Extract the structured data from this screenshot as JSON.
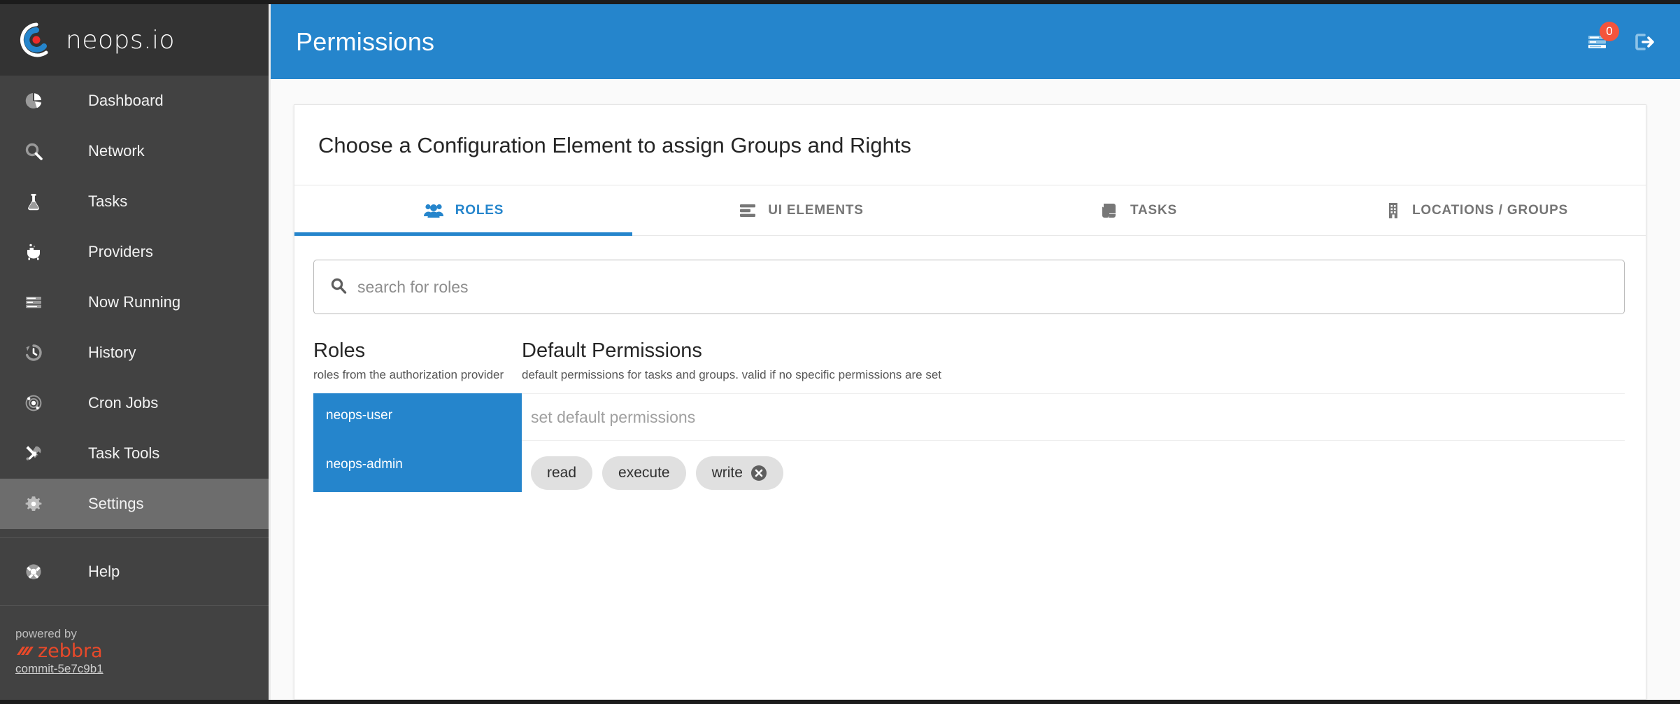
{
  "brand": {
    "name": "neops.io",
    "logo_icon": "neops-target-logo"
  },
  "sidebar": {
    "items": [
      {
        "label": "Dashboard",
        "icon": "pie-chart-icon",
        "active": false
      },
      {
        "label": "Network",
        "icon": "magnifier-icon",
        "active": false
      },
      {
        "label": "Tasks",
        "icon": "flask-icon",
        "active": false
      },
      {
        "label": "Providers",
        "icon": "cauldron-icon",
        "active": false
      },
      {
        "label": "Now Running",
        "icon": "list-lines-icon",
        "active": false
      },
      {
        "label": "History",
        "icon": "history-clock-icon",
        "active": false
      },
      {
        "label": "Cron Jobs",
        "icon": "orbit-icon",
        "active": false
      },
      {
        "label": "Task Tools",
        "icon": "wrench-screwdriver-icon",
        "active": false
      },
      {
        "label": "Settings",
        "icon": "gear-icon",
        "active": true
      }
    ],
    "help": {
      "label": "Help",
      "icon": "lifebuoy-icon"
    },
    "footer": {
      "powered_by": "powered by",
      "vendor": "zebbra",
      "commit": "commit-5e7c9b1"
    }
  },
  "topbar": {
    "title": "Permissions",
    "running_badge": "0",
    "running_icon": "running-tasks-icon",
    "logout_icon": "logout-icon"
  },
  "card": {
    "title": "Choose a Configuration Element to assign Groups and Rights",
    "tabs": [
      {
        "label": "ROLES",
        "icon": "people-group-icon",
        "active": true
      },
      {
        "label": "UI ELEMENTS",
        "icon": "list-lines-icon",
        "active": false
      },
      {
        "label": "TASKS",
        "icon": "scroll-icon",
        "active": false
      },
      {
        "label": "LOCATIONS / GROUPS",
        "icon": "building-icon",
        "active": false
      }
    ],
    "search": {
      "placeholder": "search for roles",
      "value": "",
      "icon": "search-icon"
    },
    "roles_panel": {
      "title": "Roles",
      "subtitle": "roles from the authorization provider",
      "items": [
        {
          "label": "neops-user",
          "selected": true
        },
        {
          "label": "neops-admin",
          "selected": true
        }
      ]
    },
    "permissions_panel": {
      "title": "Default Permissions",
      "subtitle": "default permissions for tasks and groups. valid if no specific permissions are set",
      "input": {
        "placeholder": "set default permissions",
        "value": ""
      },
      "chips": [
        {
          "label": "read",
          "removable": false
        },
        {
          "label": "execute",
          "removable": false
        },
        {
          "label": "write",
          "removable": true
        }
      ]
    }
  },
  "colors": {
    "accent": "#2585cc",
    "sidebar": "#424242",
    "sidebar_dark": "#333333",
    "badge": "#f4543c",
    "vendor": "#e8492a",
    "chip": "#e0e0e0"
  }
}
